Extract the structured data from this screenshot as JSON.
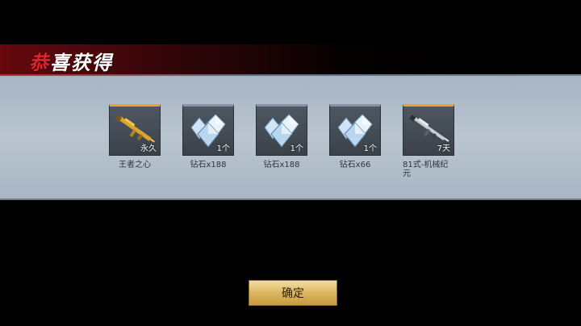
{
  "title": {
    "accent_char": "恭",
    "rest": "喜获得"
  },
  "items": [
    {
      "name": "王者之心",
      "badge": "永久",
      "icon": "golden-rifle-icon",
      "frame": "gold"
    },
    {
      "name": "钻石x188",
      "badge": "1个",
      "icon": "diamond-icon",
      "frame": "plain"
    },
    {
      "name": "钻石x188",
      "badge": "1个",
      "icon": "diamond-icon",
      "frame": "plain"
    },
    {
      "name": "钻石x66",
      "badge": "1个",
      "icon": "diamond-icon",
      "frame": "plain"
    },
    {
      "name": "81式-机械纪元",
      "badge": "7天",
      "icon": "rifle-icon",
      "frame": "gold"
    }
  ],
  "confirm_label": "确定",
  "colors": {
    "accent_red": "#e0242d",
    "gold_frame": "#e7a52a",
    "button_gold": "#d9b25c"
  }
}
